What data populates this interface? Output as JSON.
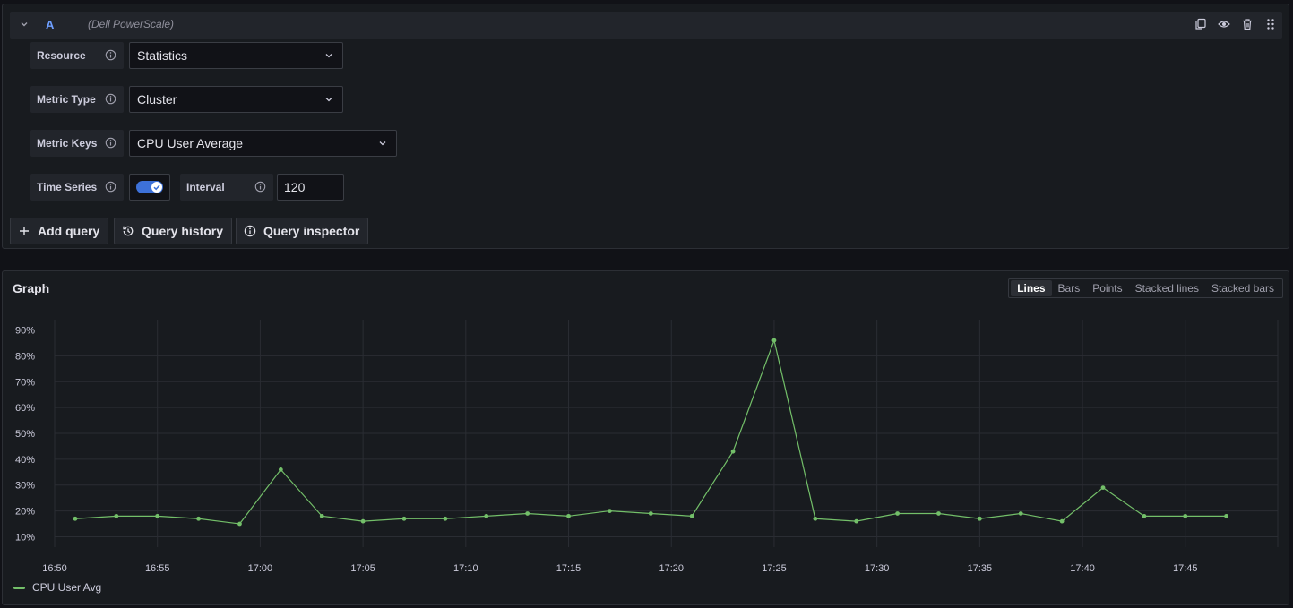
{
  "query": {
    "ref_id": "A",
    "datasource": "(Dell PowerScale)",
    "fields": {
      "resource_label": "Resource",
      "resource_value": "Statistics",
      "metric_type_label": "Metric Type",
      "metric_type_value": "Cluster",
      "metric_keys_label": "Metric Keys",
      "metric_keys_value": "CPU User Average",
      "time_series_label": "Time Series",
      "time_series_on": true,
      "interval_label": "Interval",
      "interval_value": "120"
    },
    "header_icons": [
      "copy-icon",
      "eye-icon",
      "trash-icon",
      "drag-handle-icon"
    ]
  },
  "buttons": {
    "add_query": "Add query",
    "query_history": "Query history",
    "query_inspector": "Query inspector"
  },
  "graph": {
    "title": "Graph",
    "modes": [
      "Lines",
      "Bars",
      "Points",
      "Stacked lines",
      "Stacked bars"
    ],
    "active_mode": "Lines"
  },
  "chart_data": {
    "type": "line",
    "y_ticks": [
      "90%",
      "80%",
      "70%",
      "60%",
      "50%",
      "40%",
      "30%",
      "20%",
      "10%"
    ],
    "x_ticks": [
      "16:50",
      "16:55",
      "17:00",
      "17:05",
      "17:10",
      "17:15",
      "17:20",
      "17:25",
      "17:30",
      "17:35",
      "17:40",
      "17:45"
    ],
    "ylim": [
      6,
      94
    ],
    "xlim_minutes_from_1650": [
      0,
      59.5
    ],
    "grid": true,
    "legend_position": "bottom-left",
    "series": [
      {
        "name": "CPU User Avg",
        "color": "#73bf69",
        "x": [
          "16:51",
          "16:53",
          "16:55",
          "16:57",
          "16:59",
          "17:01",
          "17:03",
          "17:05",
          "17:07",
          "17:09",
          "17:11",
          "17:13",
          "17:15",
          "17:17",
          "17:19",
          "17:21",
          "17:23",
          "17:25",
          "17:27",
          "17:29",
          "17:31",
          "17:33",
          "17:35",
          "17:37",
          "17:39",
          "17:41",
          "17:43",
          "17:45",
          "17:47"
        ],
        "values": [
          17,
          18,
          18,
          17,
          15,
          36,
          18,
          16,
          17,
          17,
          18,
          19,
          18,
          20,
          19,
          18,
          43,
          86,
          17,
          16,
          19,
          19,
          17,
          19,
          16,
          29,
          18,
          18,
          18
        ]
      }
    ]
  }
}
